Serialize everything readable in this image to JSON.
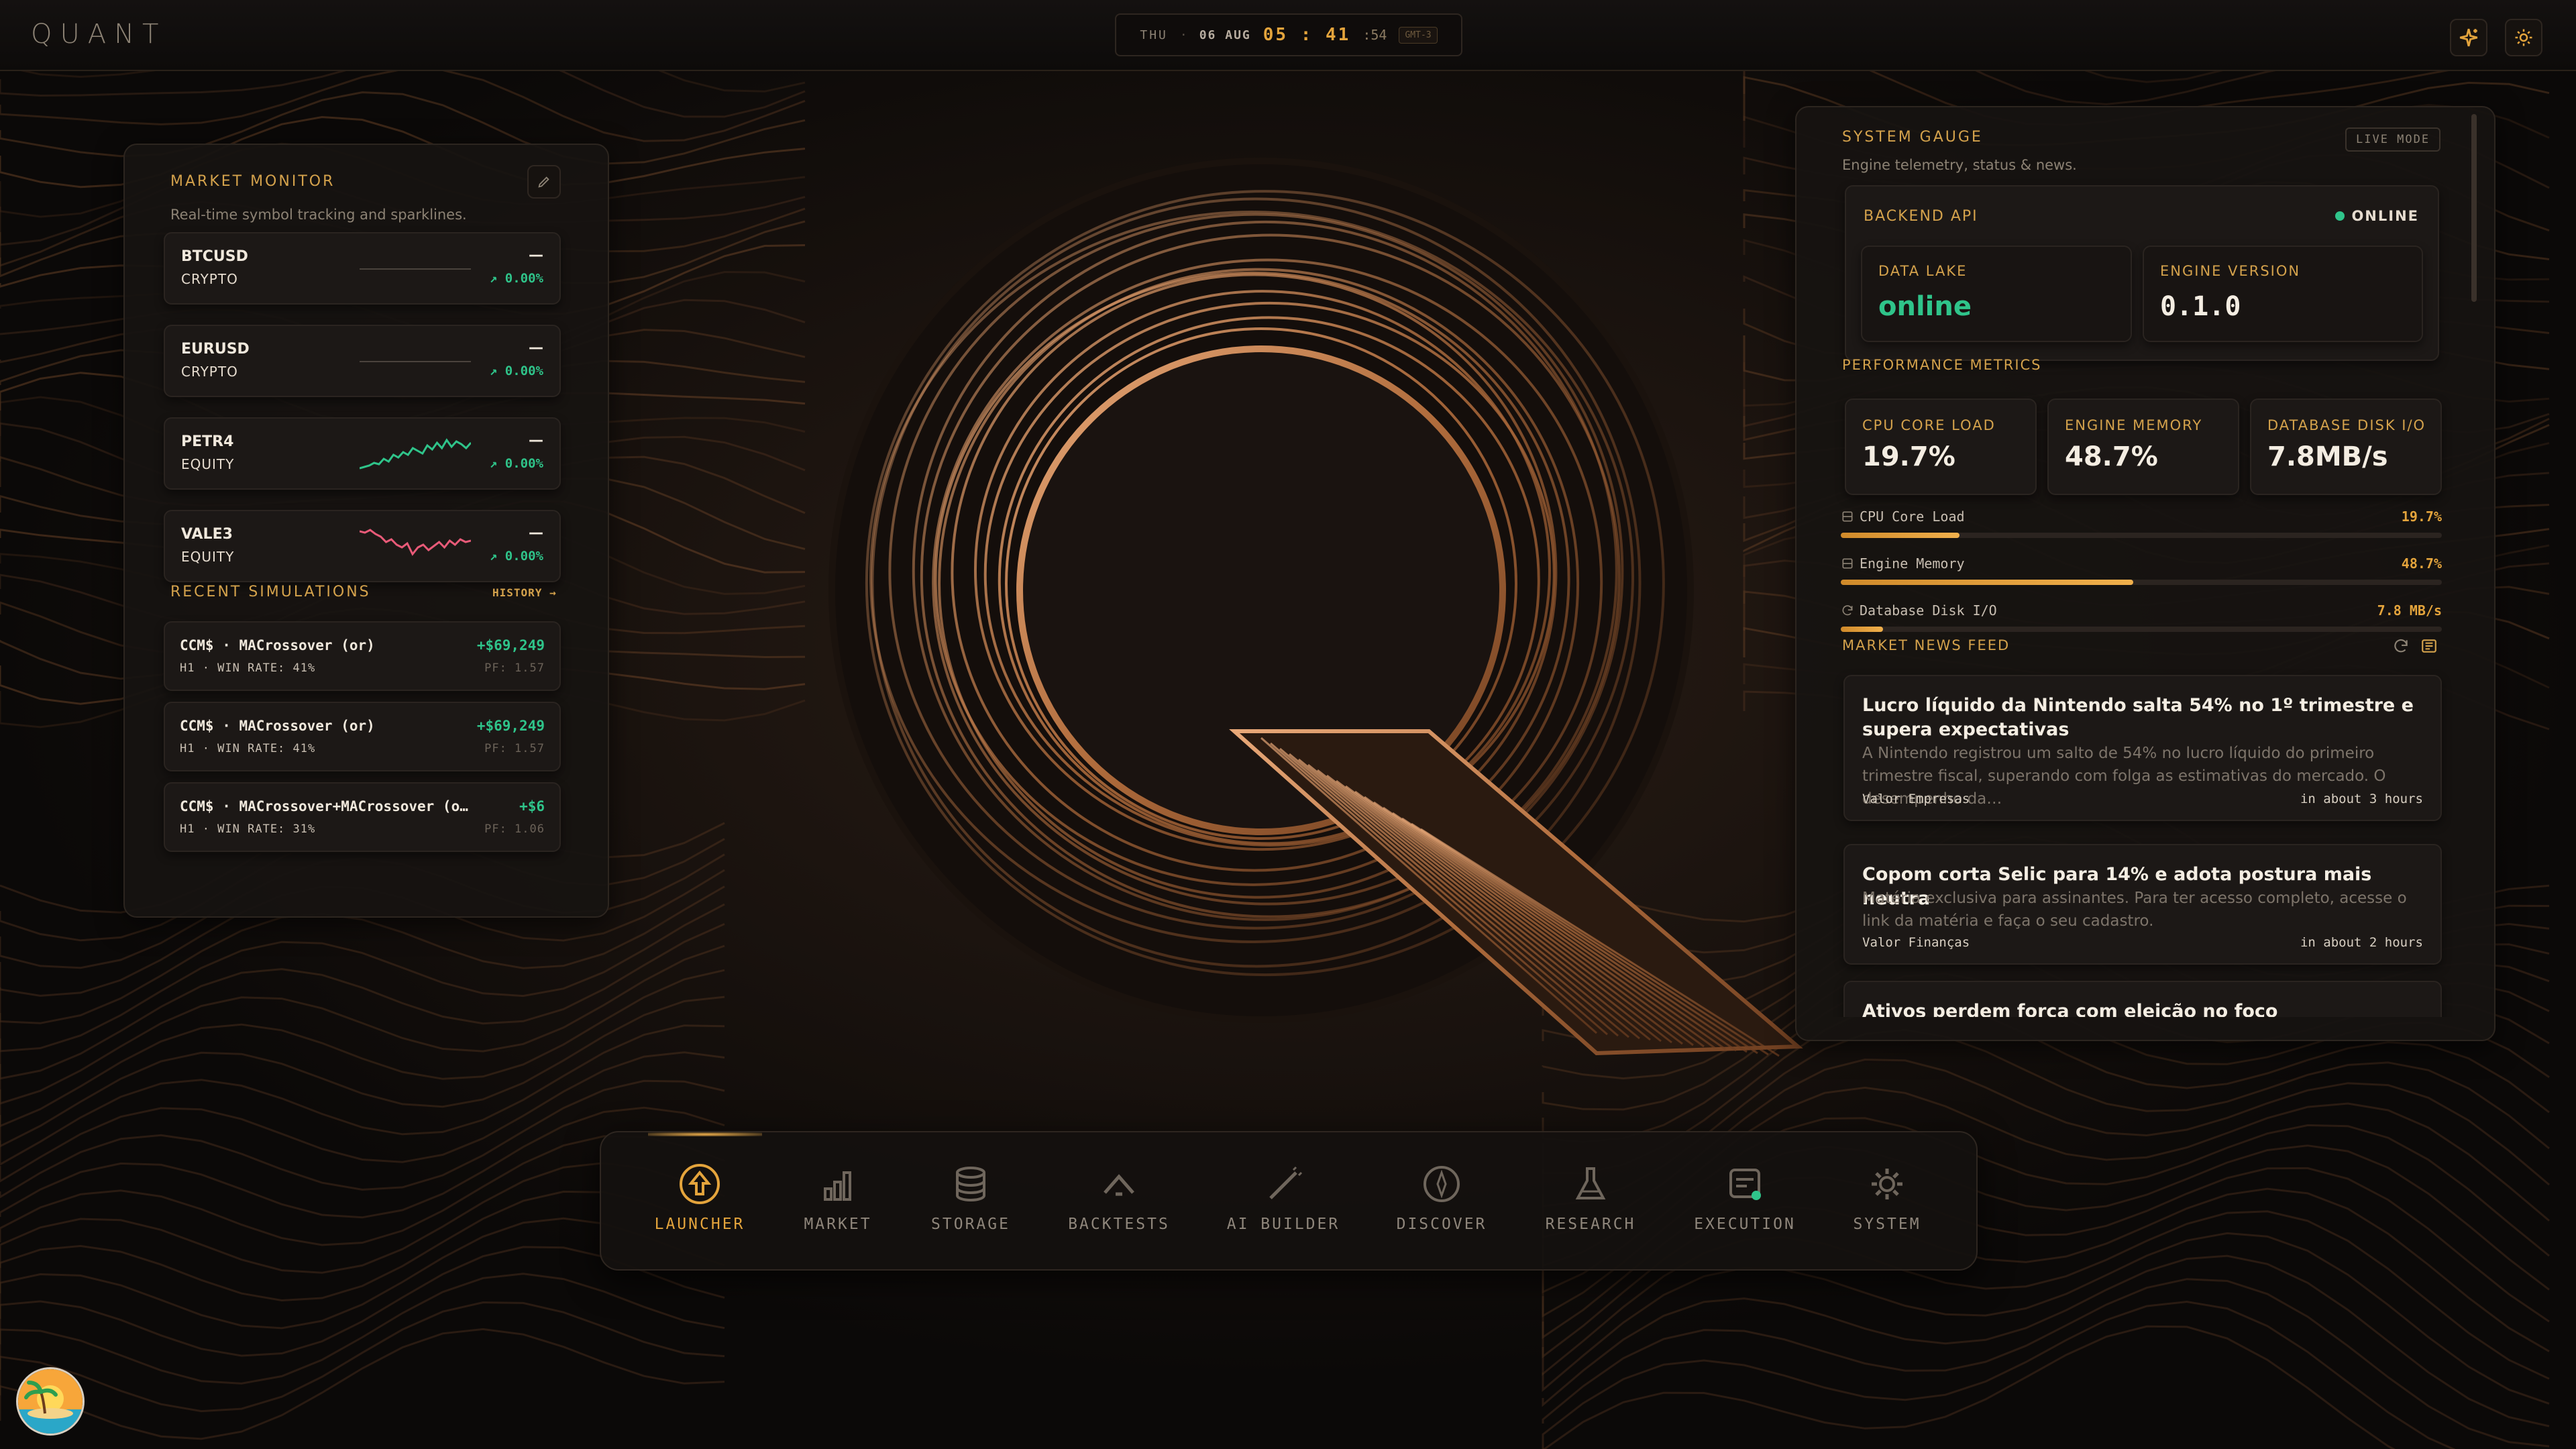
{
  "app": {
    "brand": "QUANT"
  },
  "clock": {
    "day": "THU",
    "date": "06 AUG",
    "hours": "05",
    "minutes": "41",
    "seconds": "54",
    "tz": "GMT-3"
  },
  "market_monitor": {
    "title": "MARKET MONITOR",
    "subtitle": "Real-time symbol tracking and sparklines.",
    "items": [
      {
        "symbol": "BTCUSD",
        "type": "CRYPTO",
        "price": "—",
        "change": "↗ 0.00%",
        "trend": "flat"
      },
      {
        "symbol": "EURUSD",
        "type": "CRYPTO",
        "price": "—",
        "change": "↗ 0.00%",
        "trend": "flat"
      },
      {
        "symbol": "PETR4",
        "type": "EQUITY",
        "price": "—",
        "change": "↗ 0.00%",
        "trend": "up"
      },
      {
        "symbol": "VALE3",
        "type": "EQUITY",
        "price": "—",
        "change": "↗ 0.00%",
        "trend": "down"
      }
    ]
  },
  "recent_simulations": {
    "title": "RECENT SIMULATIONS",
    "history_label": "HISTORY →",
    "items": [
      {
        "title": "CCM$ · MACrossover (or)",
        "pnl": "+$69,249",
        "meta": "H1 · WIN RATE: 41%",
        "pf": "PF: 1.57"
      },
      {
        "title": "CCM$ · MACrossover (or)",
        "pnl": "+$69,249",
        "meta": "H1 · WIN RATE: 41%",
        "pf": "PF: 1.57"
      },
      {
        "title": "CCM$ · MACrossover+MACrossover (o…",
        "pnl": "+$6",
        "meta": "H1 · WIN RATE: 31%",
        "pf": "PF: 1.06"
      }
    ]
  },
  "system_gauge": {
    "title": "SYSTEM GAUGE",
    "mode_badge": "LIVE MODE",
    "subtitle": "Engine telemetry, status & news.",
    "backend": {
      "label": "BACKEND API",
      "status": "ONLINE",
      "status_color": "#2fc48a"
    },
    "data_lake": {
      "label": "DATA LAKE",
      "value": "online"
    },
    "engine_version": {
      "label": "ENGINE VERSION",
      "value": "0.1.0"
    },
    "performance_title": "PERFORMANCE METRICS",
    "metrics": [
      {
        "label": "CPU CORE LOAD",
        "value": "19.7%"
      },
      {
        "label": "ENGINE MEMORY",
        "value": "48.7%"
      },
      {
        "label": "DATABASE DISK I/O",
        "value": "7.8MB/s"
      }
    ],
    "bars": [
      {
        "label": "CPU Core Load",
        "value": "19.7%",
        "fraction": 0.197
      },
      {
        "label": "Engine Memory",
        "value": "48.7%",
        "fraction": 0.487
      },
      {
        "label": "Database Disk I/O",
        "value": "7.8 MB/s",
        "fraction": 0.07
      }
    ],
    "news_title": "MARKET NEWS FEED",
    "news": [
      {
        "title": "Lucro líquido da Nintendo salta 54% no 1º trimestre e supera expectativas",
        "summary": "A Nintendo registrou um salto de 54% no lucro líquido do primeiro trimestre fiscal, superando com folga as estimativas do mercado. O desempenho da…",
        "source": "Valor Empresas",
        "time": "in about 3 hours"
      },
      {
        "title": "Copom corta Selic para 14% e adota postura mais neutra",
        "summary": "Matéria exclusiva para assinantes. Para ter acesso completo, acesse o link da matéria e faça o seu cadastro.",
        "source": "Valor Finanças",
        "time": "in about 2 hours"
      },
      {
        "title": "Ativos perdem força com eleição no foco",
        "summary": "",
        "source": "",
        "time": ""
      }
    ]
  },
  "dock": {
    "items": [
      {
        "label": "LAUNCHER",
        "icon": "rocket-icon",
        "active": true
      },
      {
        "label": "MARKET",
        "icon": "bar-chart-icon"
      },
      {
        "label": "STORAGE",
        "icon": "database-icon"
      },
      {
        "label": "BACKTESTS",
        "icon": "backtest-icon"
      },
      {
        "label": "AI BUILDER",
        "icon": "wand-icon"
      },
      {
        "label": "DISCOVER",
        "icon": "compass-icon"
      },
      {
        "label": "RESEARCH",
        "icon": "flask-icon"
      },
      {
        "label": "EXECUTION",
        "icon": "execution-icon"
      },
      {
        "label": "SYSTEM",
        "icon": "gear-icon"
      }
    ]
  },
  "colors": {
    "accent": "#e4a43c",
    "positive": "#2fc48a",
    "negative": "#e85a78",
    "copper": "#b07040"
  }
}
